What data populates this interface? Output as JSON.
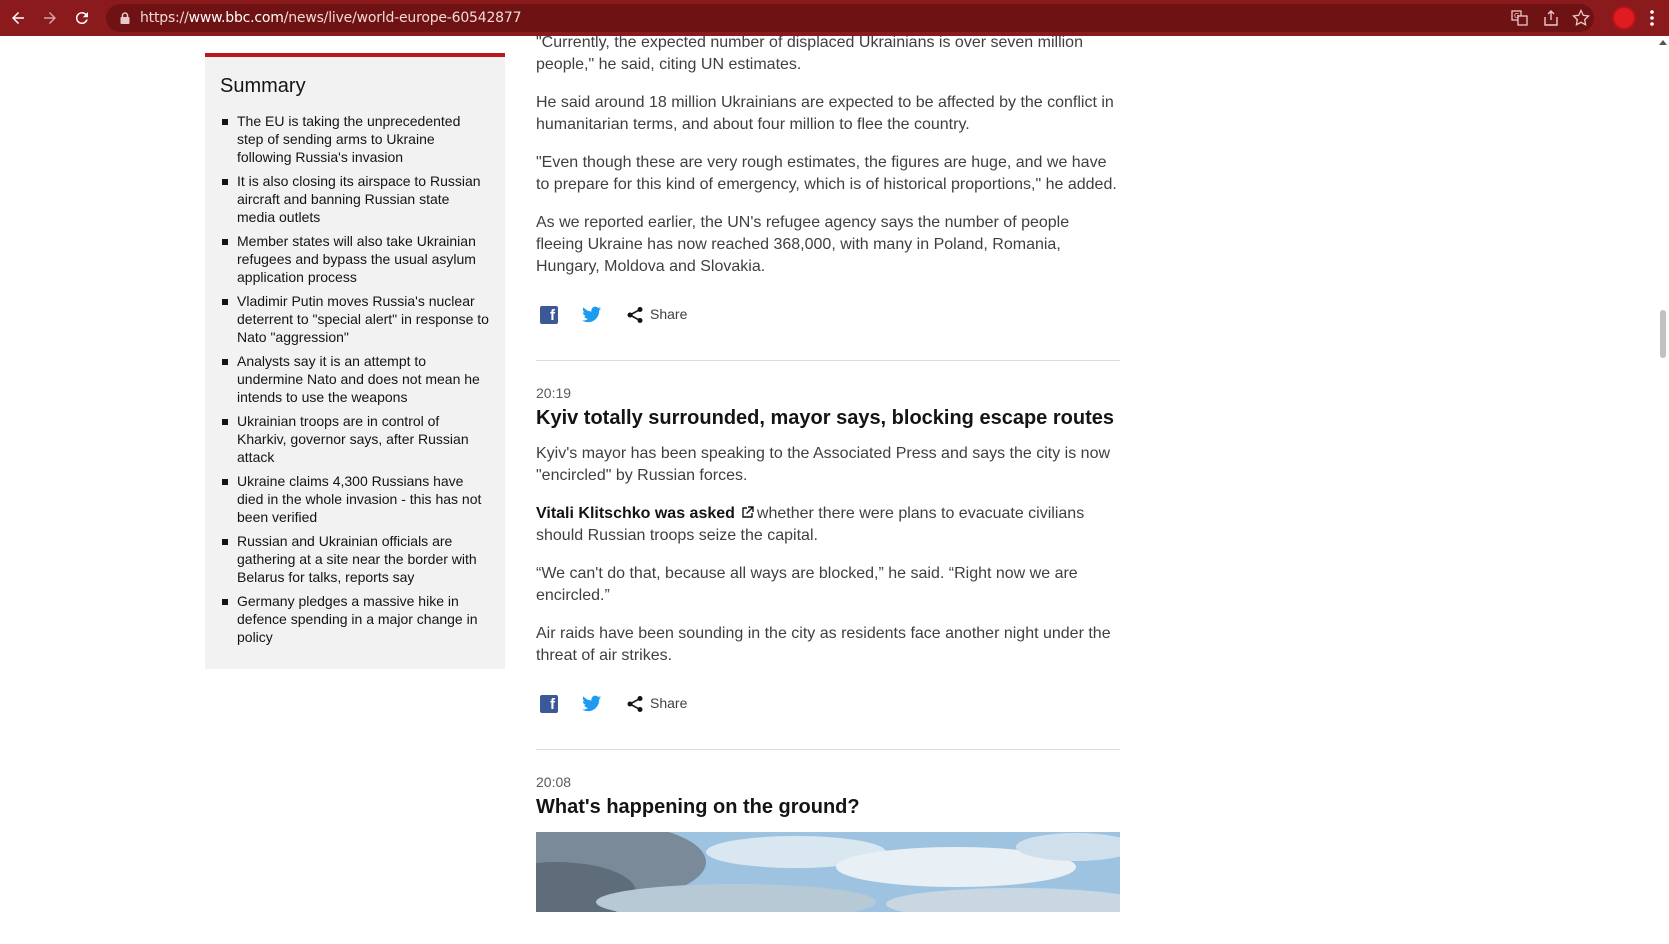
{
  "browser": {
    "url_prefix": "https://",
    "url_domain": "www.bbc.com",
    "url_path": "/news/live/world-europe-60542877",
    "accent_color": "#8b1a1d"
  },
  "summary": {
    "title": "Summary",
    "items": [
      "The EU is taking the unprecedented step of sending arms to Ukraine following Russia's invasion",
      "It is also closing its airspace to Russian aircraft and banning Russian state media outlets",
      "Member states will also take Ukrainian refugees and bypass the usual asylum application process",
      "Vladimir Putin moves Russia's nuclear deterrent to \"special alert\" in response to Nato \"aggression\"",
      "Analysts say it is an attempt to undermine Nato and does not mean he intends to use the weapons",
      "Ukrainian troops are in control of Kharkiv, governor says, after Russian attack",
      "Ukraine claims 4,300 Russians have died in the whole invasion - this has not been verified",
      "Russian and Ukrainian officials are gathering at a site near the border with Belarus for talks, reports say",
      "Germany pledges a massive hike in defence spending in a major change in policy"
    ]
  },
  "post1": {
    "p1": "\"Currently, the expected number of displaced Ukrainians is over seven million people,\" he said, citing UN estimates.",
    "p2": "He said around 18 million Ukrainians are expected to be affected by the conflict in humanitarian terms, and about four million to flee the country.",
    "p3": "\"Even though these are very rough estimates, the figures are huge, and we have to prepare for this kind of emergency, which is of historical proportions,\" he added.",
    "p4": "As we reported earlier, the UN's refugee agency says the number of people fleeing Ukraine has now reached 368,000, with many in Poland, Romania, Hungary, Moldova and Slovakia.",
    "share_label": "Share"
  },
  "post2": {
    "time": "20:19",
    "headline": "Kyiv totally surrounded, mayor says, blocking escape routes",
    "p1": "Kyiv's mayor has been speaking to the Associated Press and says the city is now \"encircled\" by Russian forces.",
    "link_text": "Vitali Klitschko was asked",
    "p2_rest": "whether there were plans to evacuate civilians should Russian troops seize the capital.",
    "p3": "“We can't do that, because all ways are blocked,” he said. “Right now we are encircled.”",
    "p4": "Air raids have been sounding in the city as residents face another night under the threat of air strikes.",
    "share_label": "Share"
  },
  "post3": {
    "time": "20:08",
    "headline": "What's happening on the ground?"
  }
}
